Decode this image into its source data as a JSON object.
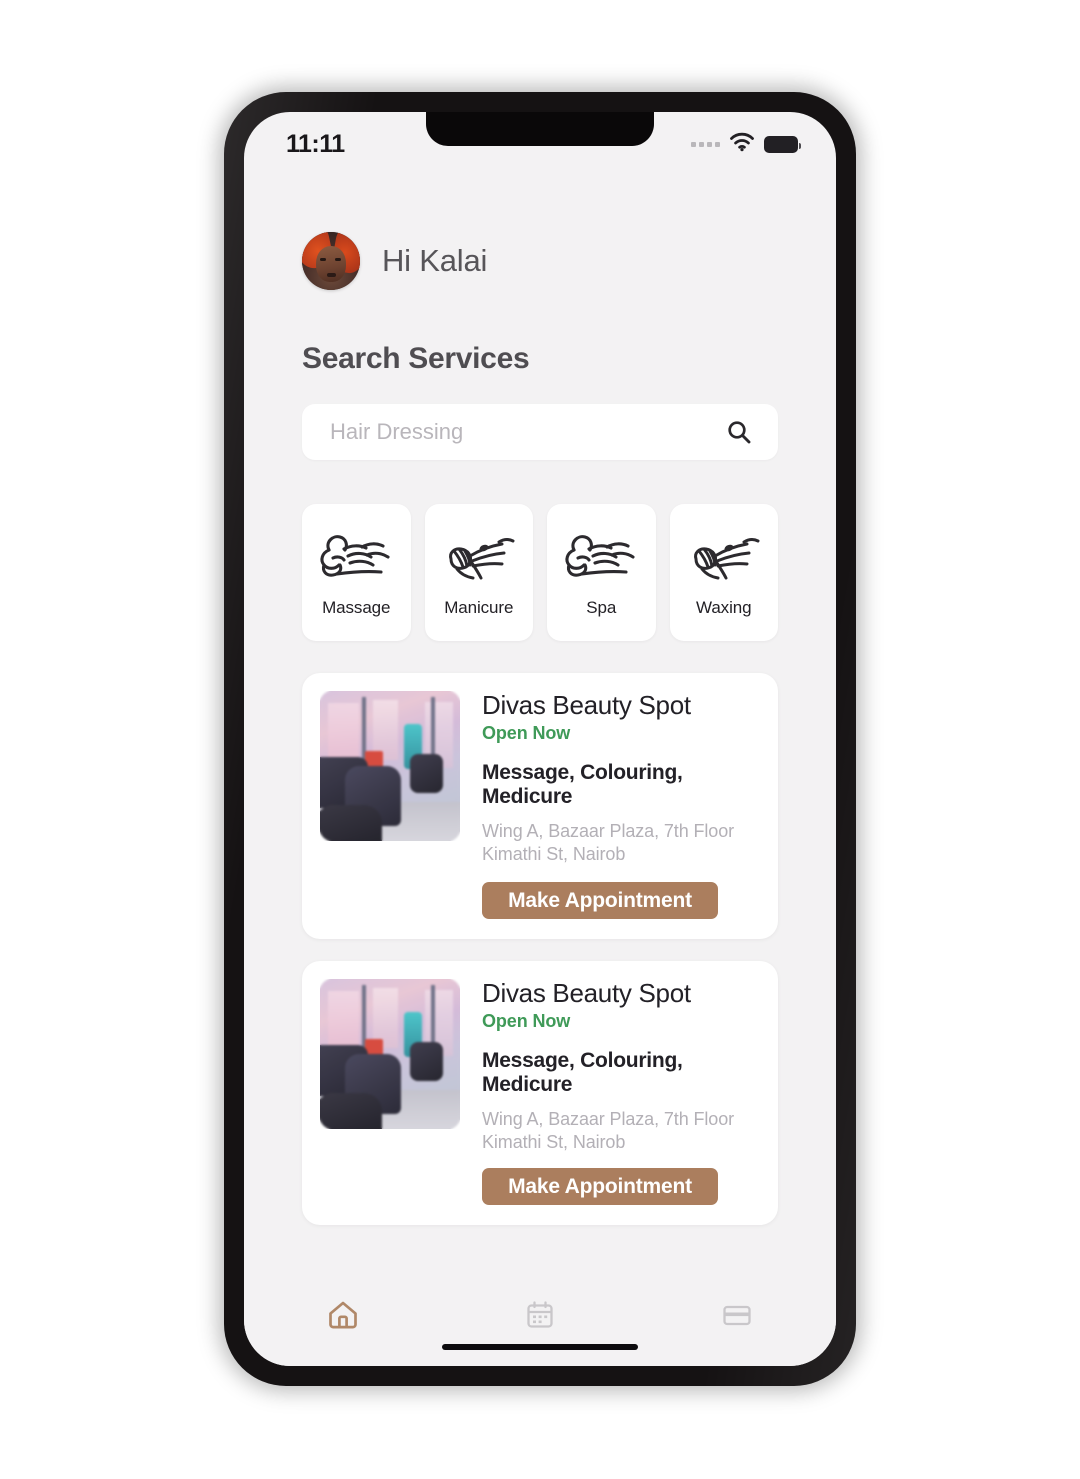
{
  "status_bar": {
    "time": "11:11",
    "signal_icon": "signal-dots-icon",
    "wifi_icon": "wifi-icon",
    "battery_icon": "battery-full-icon"
  },
  "header": {
    "greeting": "Hi Kalai",
    "avatar_alt": "user-avatar"
  },
  "search": {
    "section_title": "Search Services",
    "placeholder": "Hair Dressing",
    "value": "",
    "icon": "search-icon"
  },
  "services": [
    {
      "label": "Massage",
      "icon": "hand-massage-line-icon"
    },
    {
      "label": "Manicure",
      "icon": "hand-nails-line-icon"
    },
    {
      "label": "Spa",
      "icon": "hand-massage-line-icon"
    },
    {
      "label": "Waxing",
      "icon": "hand-nails-line-icon"
    }
  ],
  "salons": [
    {
      "name": "Divas Beauty Spot",
      "status": "Open Now",
      "services": "Message, Colouring, Medicure",
      "address": "Wing A, Bazaar Plaza, 7th Floor Kimathi St, Nairob",
      "cta": "Make Appointment",
      "thumb_alt": "salon-interior-photo"
    },
    {
      "name": "Divas Beauty Spot",
      "status": "Open Now",
      "services": "Message, Colouring, Medicure",
      "address": "Wing A, Bazaar Plaza, 7th Floor Kimathi St, Nairob",
      "cta": "Make Appointment",
      "thumb_alt": "salon-interior-photo"
    }
  ],
  "bottom_nav": [
    {
      "icon": "home-icon",
      "active": true
    },
    {
      "icon": "calendar-icon",
      "active": false
    },
    {
      "icon": "card-icon",
      "active": false
    }
  ],
  "colors": {
    "accent": "#ab7e5e",
    "accent_nav": "#b08868",
    "open_now_green": "#3f9a58",
    "screen_bg": "#f3f2f3",
    "card_bg": "#ffffff",
    "muted_text": "#b3b0b6",
    "inactive_nav": "#c9c7ca"
  }
}
